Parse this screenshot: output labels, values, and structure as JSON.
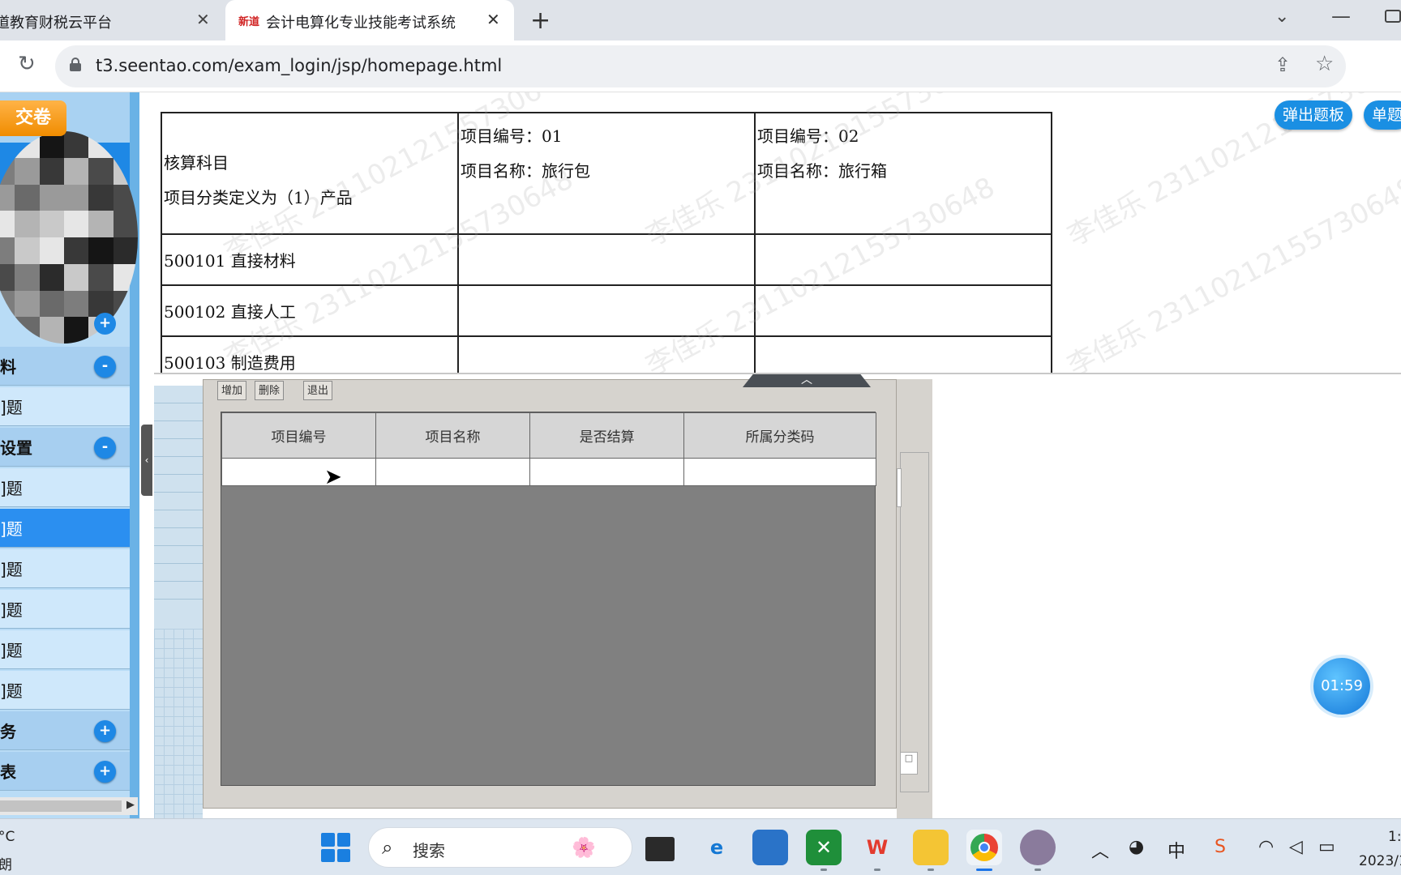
{
  "browser": {
    "tabs": [
      {
        "title": "道教育财税云平台",
        "active": false
      },
      {
        "title": "会计电算化专业技能考试系统",
        "favicon_text": "新道",
        "active": true
      }
    ],
    "url": "t3.seentao.com/exam_login/jsp/homepage.html"
  },
  "exam": {
    "submit_label": "交卷",
    "popup_board_label": "弹出题板",
    "single_question_label": "单题",
    "timer": "01:59",
    "nav": [
      {
        "label": "料",
        "type": "category",
        "toggle": "-"
      },
      {
        "label": "]题",
        "type": "item"
      },
      {
        "label": "设置",
        "type": "category",
        "toggle": "-"
      },
      {
        "label": "]题",
        "type": "item"
      },
      {
        "label": "]题",
        "type": "item",
        "active": true
      },
      {
        "label": "]题",
        "type": "item"
      },
      {
        "label": "]题",
        "type": "item"
      },
      {
        "label": "]题",
        "type": "item"
      },
      {
        "label": "]题",
        "type": "item"
      },
      {
        "label": "务",
        "type": "category",
        "toggle": "+"
      },
      {
        "label": "表",
        "type": "category",
        "toggle": "+"
      }
    ],
    "nav_top_toggle": "+",
    "question_table": {
      "header": {
        "col1_line1": "核算科目",
        "col1_line2": "项目分类定义为（1）产品",
        "col2_line1": "项目编号：01",
        "col2_line2": "项目名称：旅行包",
        "col3_line1": "项目编号：02",
        "col3_line2": "项目名称：旅行箱"
      },
      "rows": [
        {
          "account": "500101  直接材料"
        },
        {
          "account": "500102  直接人工"
        },
        {
          "account": "500103  制造费用"
        }
      ]
    },
    "watermark": "李佳乐 23110212155730648",
    "dialog": {
      "buttons": [
        "增加",
        "删除",
        "退出"
      ],
      "columns": [
        "项目编号",
        "项目名称",
        "是否结算",
        "所属分类码"
      ]
    }
  },
  "taskbar": {
    "weather_line1": "°C",
    "weather_line2": "朗",
    "search_placeholder": "搜索",
    "clock_line1": "1:",
    "clock_line2": "2023/1"
  }
}
